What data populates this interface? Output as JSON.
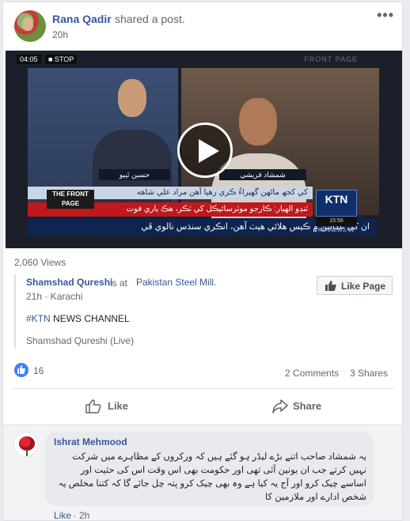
{
  "post": {
    "author": "Rana Qadir",
    "action": "shared a post.",
    "time": "20h",
    "more_glyph": "•••"
  },
  "video": {
    "timestamp": "04:05",
    "stop_label": "■ STOP",
    "watermark": "FRONT PAGE",
    "front_page_tag": "THE FRONT PAGE",
    "left_name_tag": "حسين ٿيٻو",
    "right_name_tag": "شمشاد قريشي",
    "ticker_top": "کي کجھ ماڻهن گهيراءُ ڪري رهيا آهن مراد علي شاهه",
    "ticker_mid": "ٽنڊو الهيار: ڪارجو موٽرسائيڪل کي ٽڪر، هڪ ٻاري فوت",
    "ticker_bottom": "ان کي عدالتن ۾ ڪيس هلائي هيٺ آهن، انڪري سنڌس نالوي ڦي",
    "logo_text": "KTN",
    "logo_sub_text": "LIVE NEWS",
    "logo_footer": "15:56 KTNNEWS.TV",
    "play_icon": "play-icon"
  },
  "views": "2,060 Views",
  "shared_post": {
    "author": "Shamshad Qureshi",
    "is_at": "is at",
    "place": "Pakistan Steel Mill.",
    "time_location": "21h · Karachi",
    "hashtag": "#KTN",
    "hashtag_rest": " NEWS CHANNEL",
    "live_caption": "Shamshad Qureshi (Live)"
  },
  "like_page_button": "Like Page",
  "reactions": {
    "count": "16",
    "comments": "2 Comments",
    "shares": "3 Shares"
  },
  "actions": {
    "like": "Like",
    "share": "Share"
  },
  "comment": {
    "author": "Ishrat Mehmood",
    "text": "یہ شمشاد صاحب اتنے بڑے لیڈر ہو گئے ہیں کہ ورکروں کے مظاہرے میں شرکت نہیں کرتے جب ان یونین آئی تھی اور حکومت بھی اس وقت اس کی حثیت اور اساسے چیک کرو اور آج یہ کیا ہے وہ بھی چیک کرو پتہ چل جائے گا کہ کتنا مخلص یہ شخص ادارے اور ملازمین کا",
    "like_label": "Like",
    "dot": "·",
    "time": "2h"
  },
  "colors": {
    "link": "#365899",
    "muted": "#606770",
    "like_blue": "#4080ff",
    "news_red": "#c0181d",
    "news_navy": "#0e2451"
  }
}
